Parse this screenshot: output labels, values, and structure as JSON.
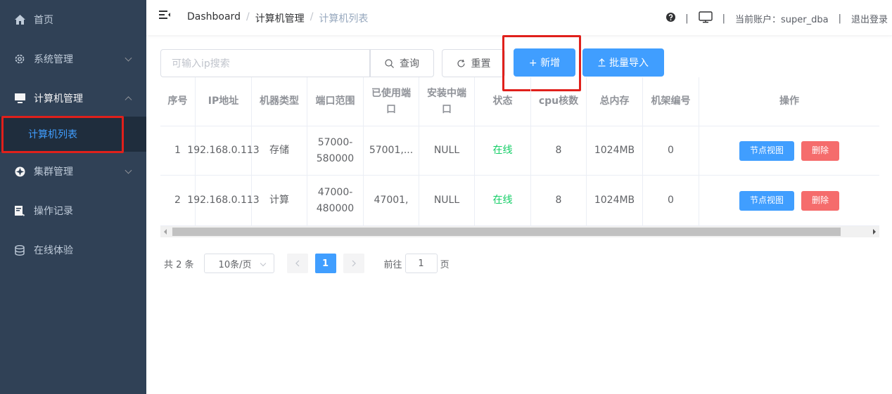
{
  "sidebar": {
    "items": [
      {
        "label": "首页",
        "icon": "home-icon"
      },
      {
        "label": "系统管理",
        "icon": "gear-icon"
      },
      {
        "label": "计算机管理",
        "icon": "monitor-icon"
      },
      {
        "label": "集群管理",
        "icon": "cluster-icon"
      },
      {
        "label": "操作记录",
        "icon": "record-icon"
      },
      {
        "label": "在线体验",
        "icon": "database-icon"
      }
    ],
    "sub_active": "计算机列表"
  },
  "header": {
    "breadcrumb": [
      "Dashboard",
      "计算机管理",
      "计算机列表"
    ],
    "account_label": "当前账户：super_dba",
    "logout": "退出登录"
  },
  "toolbar": {
    "search_placeholder": "可输入ip搜索",
    "query": "查询",
    "reset": "重置",
    "add": "+ 新增",
    "batch_import": "批量导入"
  },
  "table": {
    "headers": [
      "序号",
      "IP地址",
      "机器类型",
      "端口范围",
      "已使用端口",
      "安装中端口",
      "状态",
      "cpu核数",
      "总内存",
      "机架编号",
      "操作"
    ],
    "rows": [
      {
        "no": "1",
        "ip": "192.168.0.113",
        "type": "存储",
        "range": "57000-580000",
        "used": "57001,...",
        "installing": "NULL",
        "status": "在线",
        "cpu": "8",
        "mem": "1024MB",
        "rack": "0"
      },
      {
        "no": "2",
        "ip": "192.168.0.113",
        "type": "计算",
        "range": "47000-480000",
        "used": "47001,",
        "installing": "NULL",
        "status": "在线",
        "cpu": "8",
        "mem": "1024MB",
        "rack": "0"
      }
    ],
    "actions": {
      "view": "节点视图",
      "delete": "删除"
    }
  },
  "pagination": {
    "total": "共 2 条",
    "page_size": "10条/页",
    "current": "1",
    "goto_label": "前往",
    "goto_value": "1",
    "page_unit": "页"
  },
  "colors": {
    "sidebar_bg": "#304156",
    "primary": "#409eff",
    "danger": "#f56c6c",
    "online": "#13ce66",
    "highlight": "#e0201b"
  }
}
